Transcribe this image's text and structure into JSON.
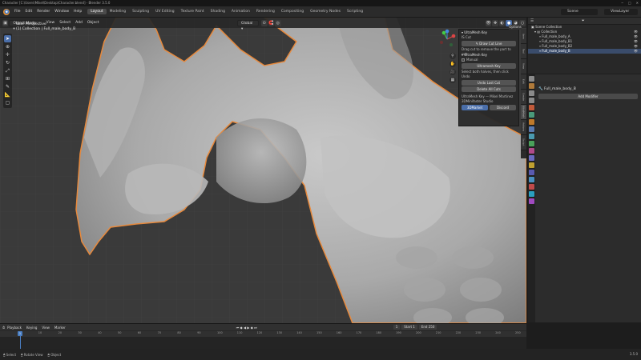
{
  "window": {
    "title": "Character [C:\\Users\\Mikel\\Desktop\\Character.blend] - Blender 3.5.0",
    "controls": [
      "─",
      "□",
      "✕"
    ]
  },
  "menubar": {
    "menus": [
      "File",
      "Edit",
      "Render",
      "Window",
      "Help"
    ],
    "workspaces": [
      "Layout",
      "Modeling",
      "Sculpting",
      "UV Editing",
      "Texture Paint",
      "Shading",
      "Animation",
      "Rendering",
      "Compositing",
      "Geometry Nodes",
      "Scripting"
    ],
    "active_workspace": "Layout",
    "scene": "Scene",
    "view_layer": "ViewLayer"
  },
  "viewport": {
    "mode": "Object Mode",
    "menus": [
      "View",
      "Select",
      "Add",
      "Object"
    ],
    "orientation": "Global",
    "overlay_line1": "User Perspective",
    "overlay_line2": "(1) Collection | Full_male_body_B",
    "accent": "#4a6ea9",
    "selection_outline": "#e7893c"
  },
  "npanel": {
    "options_label": "Options",
    "section_main": "UltraMesh Key",
    "section_cut_label": "IS Cut",
    "button_draw_cut": "Draw Cut Line",
    "hint1": "Drag cut to remove the part to cut",
    "section_key": "UltraMesh Key",
    "manual_label": "Manual",
    "button_ultramesh_key": "Ultramesh Key",
    "hint2": "Select both halves, then click",
    "undo_label": "Undo",
    "button_undo_last_cut": "Undo Last Cut",
    "button_delete_all_cuts": "Delete All Cuts",
    "credit_line1": "UltraMesh Key — Mikel Martinez",
    "credit_line2": "3DMinifaster Studio",
    "button_left": "3DMarket",
    "button_right": "Discord",
    "tabs": [
      "Item",
      "Tool",
      "View",
      "Edit",
      "Create",
      "UltraMesh",
      "Addons",
      "Sculpt"
    ]
  },
  "outliner": {
    "header": "Scene Collection",
    "rows": [
      {
        "label": "Scene Collection",
        "indent": 0,
        "selected": false
      },
      {
        "label": "Collection",
        "indent": 1,
        "selected": false
      },
      {
        "label": "Full_male_body_A",
        "indent": 2,
        "selected": false
      },
      {
        "label": "Full_male_body_B1",
        "indent": 2,
        "selected": false
      },
      {
        "label": "Full_male_body_B2",
        "indent": 2,
        "selected": false
      },
      {
        "label": "Full_male_body_B",
        "indent": 2,
        "selected": true
      }
    ]
  },
  "properties": {
    "object_name": "Full_male_body_B",
    "add_modifier": "Add Modifier",
    "tab_colors": [
      "#8a8a8a",
      "#b07a3a",
      "#8a8a8a",
      "#8a8a8a",
      "#c25a3a",
      "#4a9a7a",
      "#c07a2a",
      "#5a7ab0",
      "#4a9ab0",
      "#4aa05a",
      "#b04a8a",
      "#6a6ac0",
      "#c0a030",
      "#5a5ab0",
      "#4a90c0",
      "#c04a4a",
      "#2aa0c0",
      "#a04ac0"
    ]
  },
  "timeline": {
    "menus": [
      "Playback",
      "Keying",
      "View",
      "Marker"
    ],
    "start_label": "Start",
    "start": "1",
    "end_label": "End",
    "end": "250",
    "current": "1",
    "ticks": [
      "0",
      "10",
      "20",
      "30",
      "40",
      "50",
      "60",
      "70",
      "80",
      "90",
      "100",
      "110",
      "120",
      "130",
      "140",
      "150",
      "160",
      "170",
      "180",
      "190",
      "200",
      "210",
      "220",
      "230",
      "240",
      "250"
    ]
  },
  "statusbar": {
    "items": [
      "Select",
      "Rotate View",
      "Object"
    ],
    "version": "3.5.0"
  }
}
